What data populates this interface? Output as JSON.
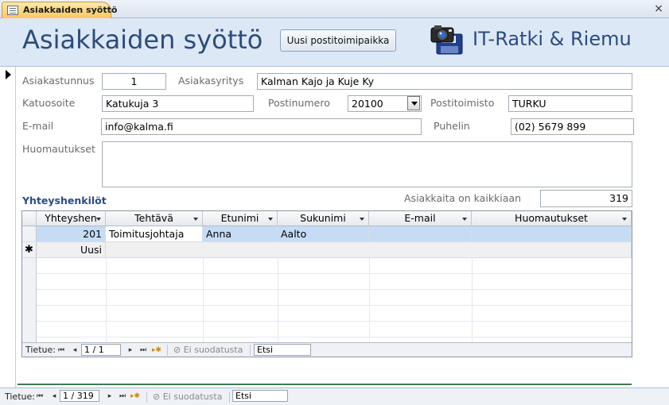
{
  "tab": {
    "label": "Asiakkaiden syöttö",
    "close": "×"
  },
  "header": {
    "title": "Asiakkaiden syöttö",
    "new_postal_button": "Uusi postitoimipaikka",
    "company": "IT-Ratki & Riemu"
  },
  "form": {
    "asiakastunnus": {
      "label": "Asiakastunnus",
      "value": "1"
    },
    "asiakasyritys": {
      "label": "Asiakasyritys",
      "value": "Kalman Kajo ja Kuje Ky"
    },
    "katuosoite": {
      "label": "Katuosoite",
      "value": "Katukuja 3"
    },
    "postinumero": {
      "label": "Postinumero",
      "value": "20100"
    },
    "postitoimisto": {
      "label": "Postitoimisto",
      "value": "TURKU"
    },
    "email": {
      "label": "E-mail",
      "value": "info@kalma.fi"
    },
    "puhelin": {
      "label": "Puhelin",
      "value": "(02) 5679 899"
    },
    "huomautukset": {
      "label": "Huomautukset",
      "value": ""
    },
    "total": {
      "label": "Asiakkaita on kaikkiaan",
      "value": "319"
    }
  },
  "subform": {
    "title": "Yhteyshenkilöt",
    "columns": [
      "Yhteyshen",
      "Tehtävä",
      "Etunimi",
      "Sukunimi",
      "E-mail",
      "Huomautukset"
    ],
    "rows": [
      {
        "id": "201",
        "tehtava": "Toimitusjohtaja",
        "etunimi": "Anna",
        "sukunimi": "Aalto",
        "email": "",
        "huom": ""
      }
    ],
    "new_row_label": "Uusi",
    "new_row_marker": "✱",
    "nav": {
      "label": "Tietue:",
      "position": "1 / 1",
      "filter": "Ei suodatusta",
      "search": "Etsi"
    }
  },
  "main_nav": {
    "label": "Tietue:",
    "position": "1 / 319",
    "filter": "Ei suodatusta",
    "search": "Etsi"
  },
  "colors": {
    "header_bg": "#dde8f6",
    "title": "#2d4d7a",
    "tab": "#f7c865",
    "selected_row": "#c6dcf5"
  }
}
